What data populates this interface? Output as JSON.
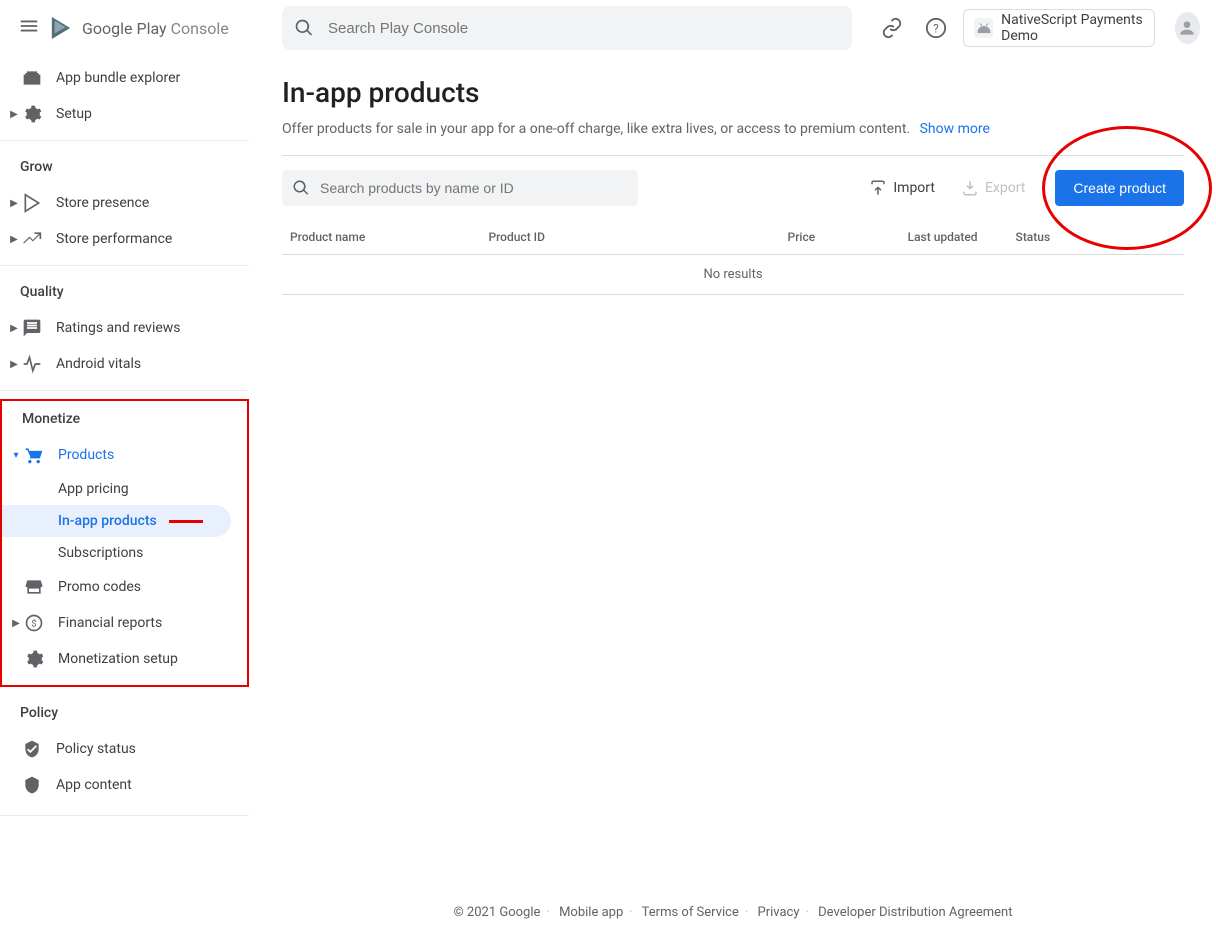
{
  "brand": {
    "name1": "Google Play",
    "name2": " Console"
  },
  "search": {
    "placeholder": "Search Play Console"
  },
  "appChip": {
    "name": "NativeScript Payments Demo"
  },
  "sidebar": {
    "appBundle": "App bundle explorer",
    "setup": "Setup",
    "grow": "Grow",
    "storePresence": "Store presence",
    "storePerformance": "Store performance",
    "quality": "Quality",
    "ratings": "Ratings and reviews",
    "vitals": "Android vitals",
    "monetize": "Monetize",
    "products": "Products",
    "appPricing": "App pricing",
    "inApp": "In-app products",
    "subscriptions": "Subscriptions",
    "promoCodes": "Promo codes",
    "financialReports": "Financial reports",
    "monetizationSetup": "Monetization setup",
    "policy": "Policy",
    "policyStatus": "Policy status",
    "appContent": "App content"
  },
  "page": {
    "title": "In-app products",
    "subtitle": "Offer products for sale in your app for a one-off charge, like extra lives, or access to premium content.",
    "showMore": "Show more"
  },
  "toolbar": {
    "searchPlaceholder": "Search products by name or ID",
    "import": "Import",
    "export": "Export",
    "create": "Create product"
  },
  "table": {
    "headers": {
      "name": "Product name",
      "id": "Product ID",
      "price": "Price",
      "updated": "Last updated",
      "status": "Status"
    },
    "noResults": "No results"
  },
  "footer": {
    "copyright": "© 2021 Google",
    "mobile": "Mobile app",
    "terms": "Terms of Service",
    "privacy": "Privacy",
    "agreement": "Developer Distribution Agreement"
  }
}
